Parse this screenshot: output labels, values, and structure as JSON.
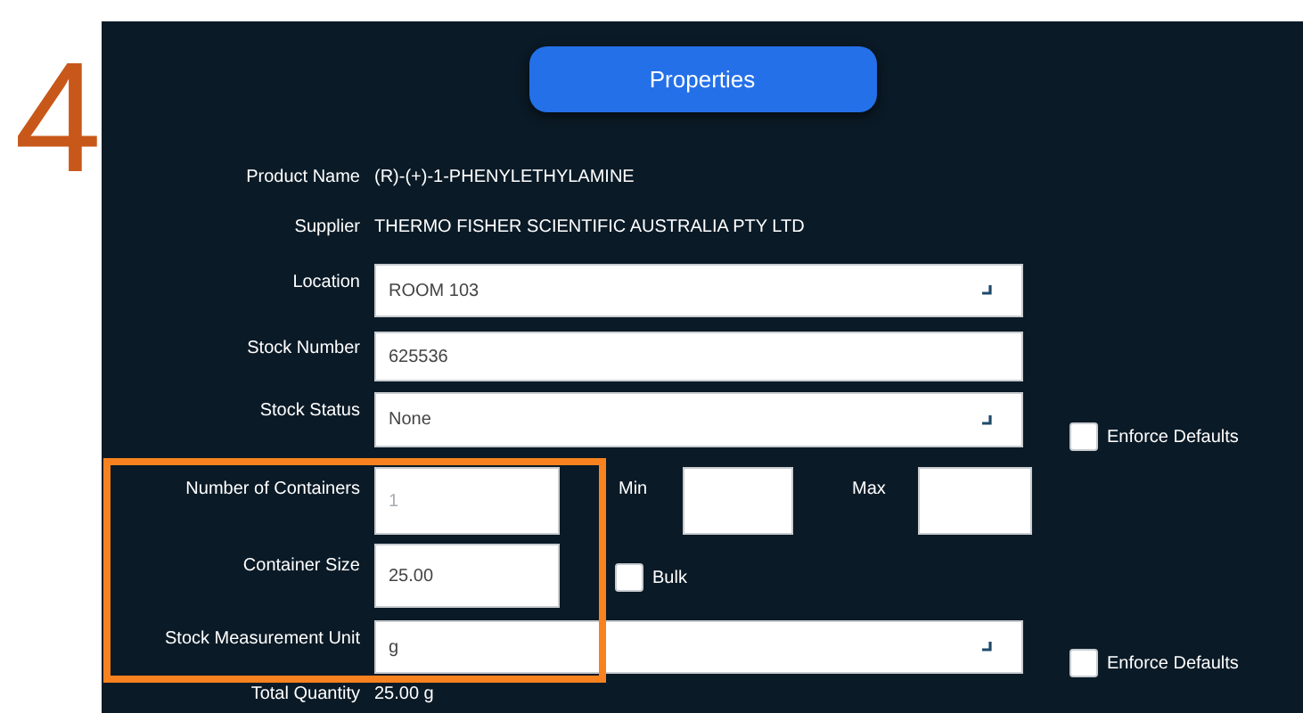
{
  "step": "4",
  "properties_button": {
    "label": "Properties"
  },
  "info": [
    {
      "label": "Product Name",
      "value": "(R)-(+)-1-PHENYLETHYLAMINE"
    },
    {
      "label": "Supplier",
      "value": "THERMO FISHER SCIENTIFIC AUSTRALIA PTY LTD"
    }
  ],
  "location": {
    "label": "Location",
    "value": "ROOM 103"
  },
  "stock_number": {
    "label": "Stock Number",
    "value": "625536"
  },
  "stock_status": {
    "label": "Stock Status",
    "value": "None",
    "enforce_defaults": {
      "label": "Enforce Defaults",
      "checked": false
    }
  },
  "number_of_containers": {
    "label": "Number of Containers",
    "value": "1",
    "disabled": true
  },
  "min": {
    "label": "Min"
  },
  "max": {
    "label": "Max"
  },
  "container_size": {
    "label": "Container Size",
    "value": "25.00",
    "disabled": false
  },
  "bulk": {
    "label": "Bulk",
    "checked": false
  },
  "stock_measurement_unit": {
    "label": "Stock Measurement Unit",
    "value": "g",
    "enforce_defaults": {
      "label": "Enforce Defaults",
      "checked": false
    }
  },
  "total_quantity": {
    "label": "Total Quantity",
    "value": "25.00 g"
  }
}
